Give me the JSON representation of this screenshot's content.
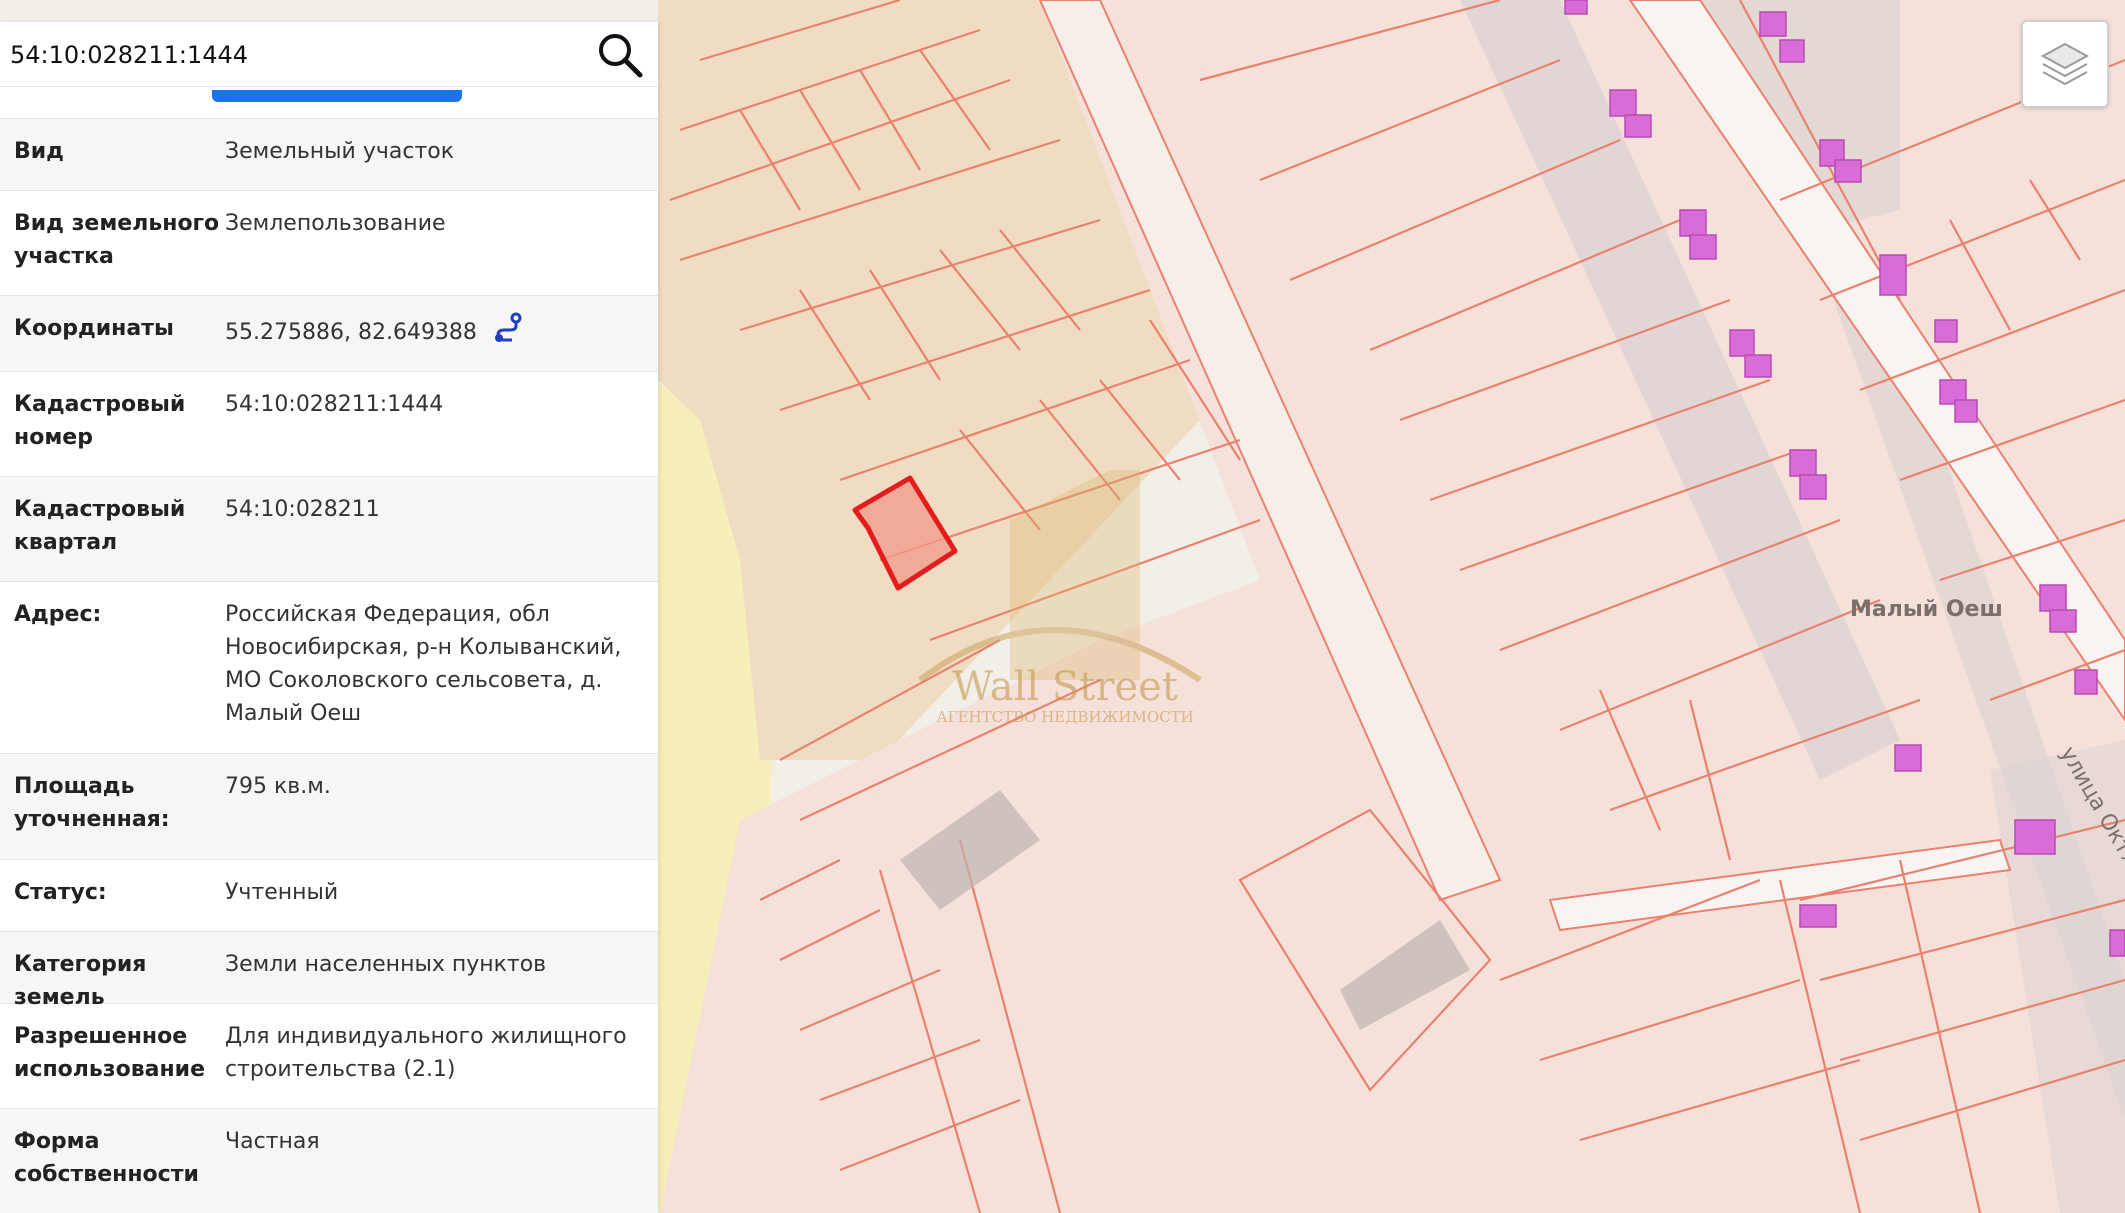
{
  "search": {
    "value": "54:10:028211:1444",
    "icon": "search-icon"
  },
  "panel": {
    "rows": [
      {
        "label": "Вид",
        "value": "Земельный участок"
      },
      {
        "label": "Вид земельного участка",
        "value": "Землепользование"
      },
      {
        "label": "Координаты",
        "value": "55.275886, 82.649388"
      },
      {
        "label": "Кадастровый номер",
        "value": "54:10:028211:1444"
      },
      {
        "label": "Кадастровый квартал",
        "value": "54:10:028211"
      },
      {
        "label": "Адрес:",
        "value": "Российская Федерация, обл Новосибирская, р-н Колыванский, МО Соколовского сельсовета, д. Малый Оеш"
      },
      {
        "label": "Площадь уточненная:",
        "value": "795 кв.м."
      },
      {
        "label": "Статус:",
        "value": "Учтенный"
      },
      {
        "label": "Категория земель",
        "value": "Земли населенных пунктов"
      },
      {
        "label": "Разрешенное использование",
        "value": "Для индивидуального жилищного строительства (2.1)"
      },
      {
        "label": "Форма собственности",
        "value": "Частная"
      }
    ]
  },
  "map": {
    "place_label": "Малый Оеш",
    "street_label": "улица Октябр",
    "watermark_title": "Wall Street",
    "watermark_subtitle": "АГЕНТСТВО НЕДВИЖИМОСТИ",
    "layers_icon": "layers-icon",
    "colors": {
      "parcel_stroke": "#e8826f",
      "parcel_fill": "#f6ddd3",
      "selected_parcel": "#e11d1d",
      "building": "#d96cd6",
      "zone_yellow": "#f7f0b8",
      "zone_tan": "#f0dcc0"
    }
  }
}
